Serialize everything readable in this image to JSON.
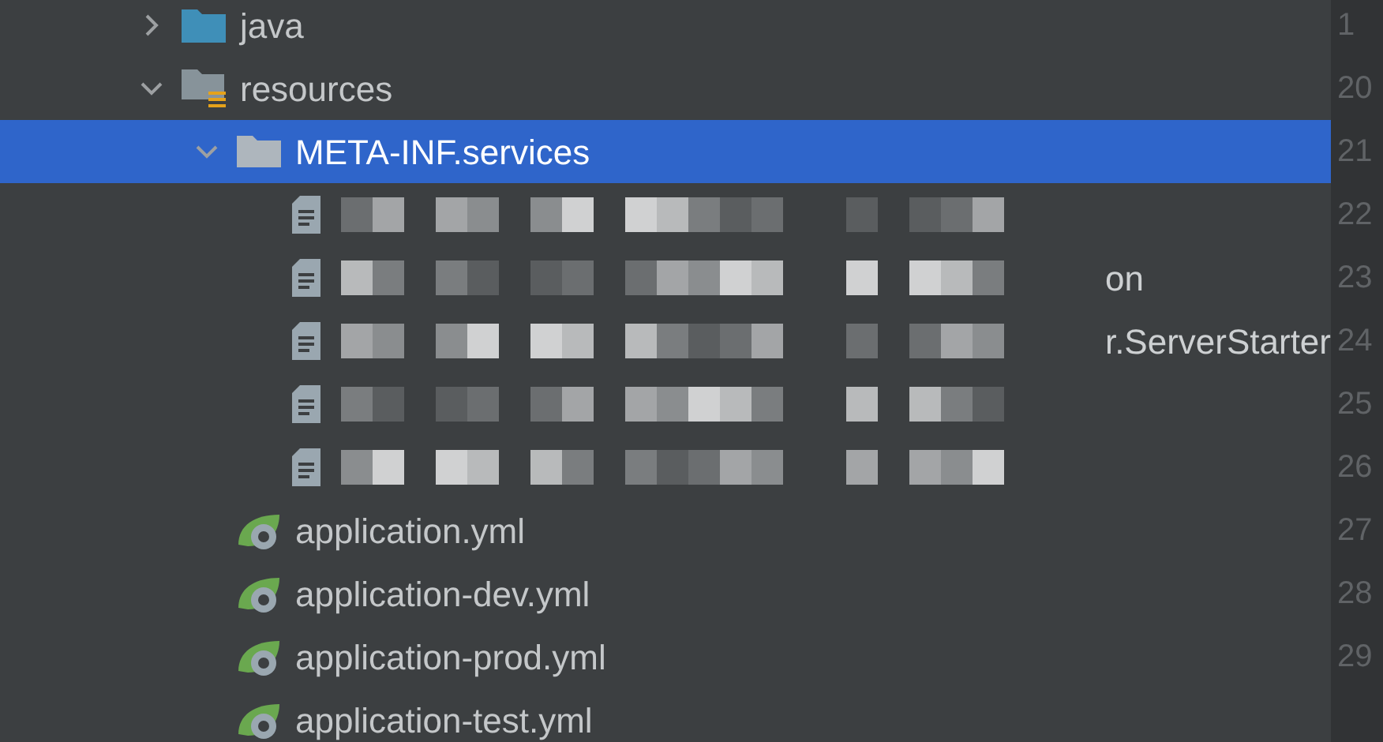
{
  "tree": [
    {
      "kind": "source-folder",
      "label": "java",
      "expanded": false,
      "selected": false
    },
    {
      "kind": "resource-folder",
      "label": "resources",
      "expanded": true,
      "selected": false,
      "children": [
        {
          "kind": "folder",
          "label": "META-INF.services",
          "expanded": true,
          "selected": true,
          "children": [
            {
              "kind": "redacted-file",
              "selected": false
            },
            {
              "kind": "redacted-file",
              "label": "on",
              "selected": false
            },
            {
              "kind": "redacted-file",
              "label": "r.ServerStarter",
              "selected": false
            },
            {
              "kind": "redacted-file",
              "selected": false
            },
            {
              "kind": "redacted-file",
              "selected": false
            }
          ]
        },
        {
          "kind": "spring-file",
          "label": "application.yml",
          "selected": false
        },
        {
          "kind": "spring-file",
          "label": "application-dev.yml",
          "selected": false
        },
        {
          "kind": "spring-file",
          "label": "application-prod.yml",
          "selected": false
        },
        {
          "kind": "spring-file",
          "label": "application-test.yml",
          "selected": false
        }
      ]
    }
  ],
  "gutter": {
    "line_numbers": [
      "1",
      "20",
      "21",
      "22",
      "23",
      "24",
      "25",
      "26",
      "27",
      "28",
      "29"
    ]
  }
}
